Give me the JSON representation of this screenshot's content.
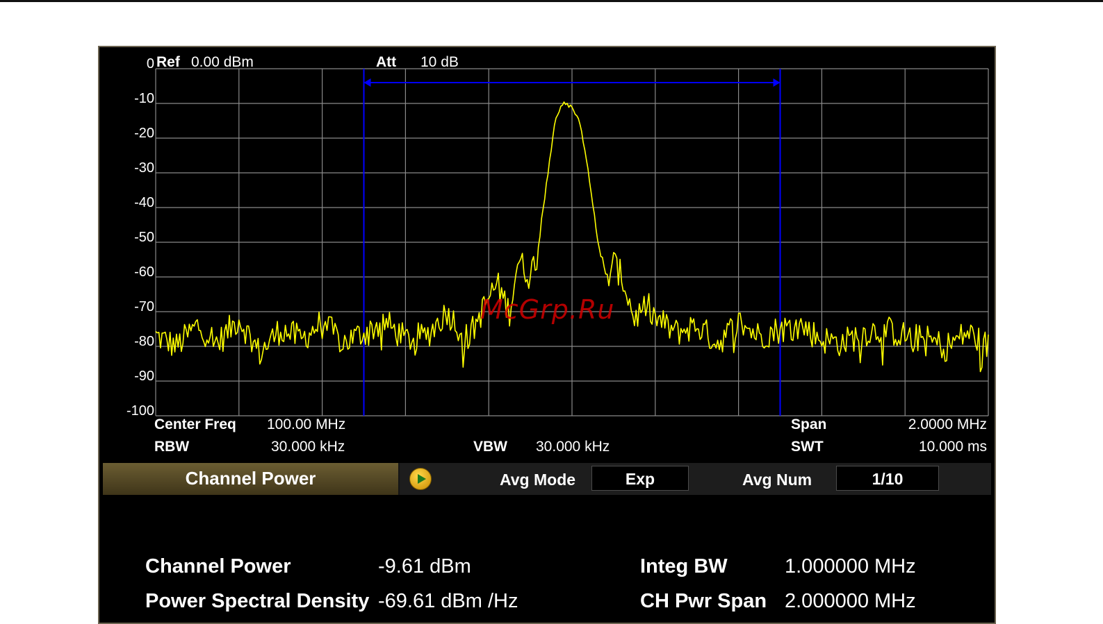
{
  "display": {
    "ref_label": "Ref",
    "ref_value": "0.00 dBm",
    "att_label": "Att",
    "att_value": "10 dB",
    "center_freq_label": "Center Freq",
    "center_freq_value": "100.00 MHz",
    "span_label": "Span",
    "span_value": "2.0000 MHz",
    "rbw_label": "RBW",
    "rbw_value": "30.000 kHz",
    "vbw_label": "VBW",
    "vbw_value": "30.000 kHz",
    "swt_label": "SWT",
    "swt_value": "10.000 ms",
    "watermark": "McGrp.Ru"
  },
  "measurement_header": {
    "title": "Channel Power",
    "avg_mode_label": "Avg Mode",
    "avg_mode_value": "Exp",
    "avg_num_label": "Avg  Num",
    "avg_num_value": "1/10",
    "play_icon": "play-icon"
  },
  "results": {
    "channel_power_label": "Channel Power",
    "channel_power_value": "-9.61 dBm",
    "psd_label": "Power Spectral Density",
    "psd_value": "-69.61 dBm /Hz",
    "integ_bw_label": "Integ BW",
    "integ_bw_value": "1.000000 MHz",
    "ch_pwr_span_label": "CH Pwr Span",
    "ch_pwr_span_value": "2.000000 MHz"
  },
  "colors": {
    "trace": "#ffff00",
    "channel_markers": "#0000ff",
    "grid": "#8a8a8a",
    "header_title_bg": "#5a4d28"
  },
  "chart_data": {
    "type": "line",
    "xlabel": "",
    "ylabel": "",
    "x_unit": "MHz",
    "y_unit": "dBm",
    "xlim": [
      99.0,
      101.0
    ],
    "ylim": [
      -100,
      0
    ],
    "yticks": [
      "0",
      "-10",
      "-20",
      "-30",
      "-40",
      "-50",
      "-60",
      "-70",
      "-80",
      "-90",
      "-100"
    ],
    "grid": true,
    "channel_band": [
      99.5,
      100.5
    ],
    "series": [
      {
        "x": [
          99.0,
          99.05,
          99.1,
          99.15,
          99.2,
          99.25,
          99.3,
          99.35,
          99.4,
          99.45,
          99.5,
          99.55,
          99.6,
          99.65,
          99.7,
          99.75,
          99.8,
          99.82,
          99.85,
          99.87,
          99.9,
          99.92,
          99.94,
          99.96,
          99.98,
          100.0,
          100.02,
          100.04,
          100.06,
          100.08,
          100.1,
          100.12,
          100.15,
          100.18,
          100.2,
          100.25,
          100.3,
          100.35,
          100.4,
          100.45,
          100.5,
          100.55,
          100.6,
          100.65,
          100.7,
          100.75,
          100.8,
          100.85,
          100.9,
          100.95,
          101.0
        ],
        "y": [
          -77,
          -80,
          -74,
          -79,
          -72,
          -82,
          -75,
          -78,
          -73,
          -79,
          -76,
          -73,
          -78,
          -77,
          -70,
          -78,
          -66,
          -62,
          -70,
          -55,
          -60,
          -50,
          -32,
          -14,
          -10,
          -11,
          -16,
          -30,
          -48,
          -62,
          -56,
          -60,
          -72,
          -68,
          -72,
          -76,
          -74,
          -79,
          -73,
          -77,
          -75,
          -74,
          -78,
          -79,
          -76,
          -75,
          -77,
          -78,
          -80,
          -76,
          -80
        ]
      }
    ]
  }
}
